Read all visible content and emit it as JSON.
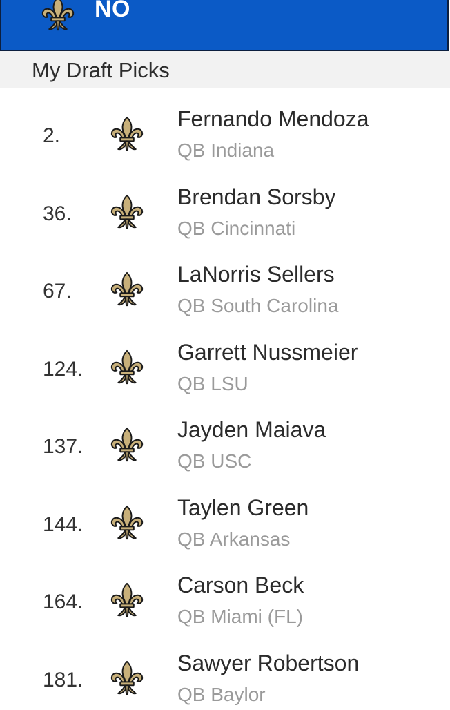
{
  "header": {
    "team_abbr": "NO",
    "logo_icon": "fleur-de-lis-icon",
    "background_color": "#0b5ac6"
  },
  "section": {
    "title": "My Draft Picks"
  },
  "picks": [
    {
      "number": "2.",
      "name": "Fernando Mendoza",
      "detail": "QB Indiana",
      "team_icon": "fleur-de-lis-icon"
    },
    {
      "number": "36.",
      "name": "Brendan Sorsby",
      "detail": "QB Cincinnati",
      "team_icon": "fleur-de-lis-icon"
    },
    {
      "number": "67.",
      "name": "LaNorris Sellers",
      "detail": "QB South Carolina",
      "team_icon": "fleur-de-lis-icon"
    },
    {
      "number": "124.",
      "name": "Garrett Nussmeier",
      "detail": "QB LSU",
      "team_icon": "fleur-de-lis-icon"
    },
    {
      "number": "137.",
      "name": "Jayden Maiava",
      "detail": "QB USC",
      "team_icon": "fleur-de-lis-icon"
    },
    {
      "number": "144.",
      "name": "Taylen Green",
      "detail": "QB Arkansas",
      "team_icon": "fleur-de-lis-icon"
    },
    {
      "number": "164.",
      "name": "Carson Beck",
      "detail": "QB Miami (FL)",
      "team_icon": "fleur-de-lis-icon"
    },
    {
      "number": "181.",
      "name": "Sawyer Robertson",
      "detail": "QB Baylor",
      "team_icon": "fleur-de-lis-icon"
    }
  ],
  "colors": {
    "logo_gold": "#c8b07a",
    "logo_outline": "#1a1a1a",
    "name_text": "#2b2b2b",
    "detail_text": "#9a9a9a"
  }
}
